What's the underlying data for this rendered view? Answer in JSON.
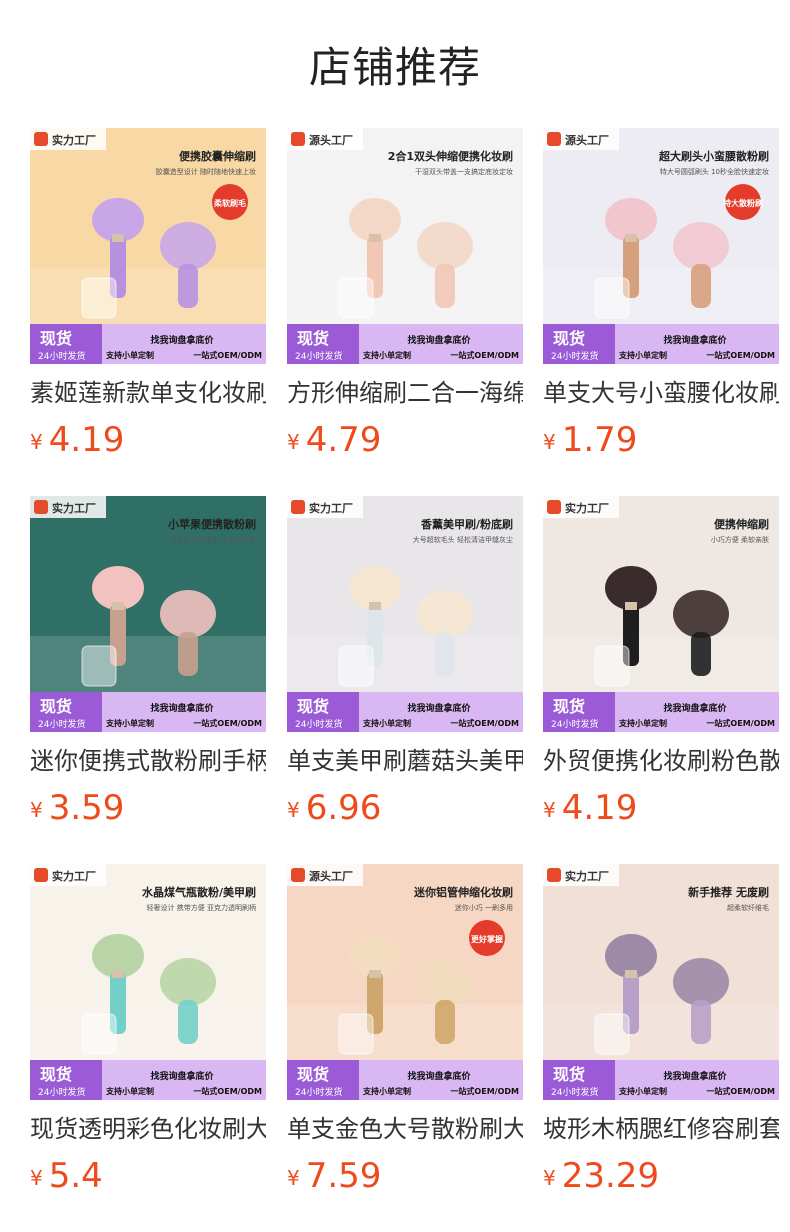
{
  "page_title": "店铺推荐",
  "currency": "¥",
  "colors": {
    "price": "#ee4a1c",
    "banner": "#9b5bd6",
    "banner_light": "#d9b7f2"
  },
  "products": [
    {
      "title": "素姬莲新款单支化妆刷",
      "price": "4.19",
      "image": {
        "bg": "#f8d9a6",
        "badge": "实力工厂",
        "headline": "便携胶囊伸缩刷",
        "subline": "胶囊造型设计 随时随地快速上妆",
        "sticker": "柔软刷毛",
        "tag_main": "现货",
        "tag_sub": "24小时发货",
        "banner_top": "找我询盘拿底价",
        "banner_left": "支持小单定制",
        "banner_right": "一站式OEM/ODM",
        "brush_head": "#c8a6e8",
        "brush_handle": "#b791e0"
      }
    },
    {
      "title": "方形伸缩刷二合一海绵",
      "price": "4.79",
      "image": {
        "bg": "#f3f3f3",
        "badge": "源头工厂",
        "headline": "2合1双头伸缩便携化妆刷",
        "subline": "干湿双头带盖一支搞定底妆定妆",
        "sticker": "",
        "tag_main": "现货",
        "tag_sub": "24小时发货",
        "banner_top": "找我询盘拿底价",
        "banner_left": "支持小单定制",
        "banner_right": "一站式OEM/ODM",
        "brush_head": "#f3d8c8",
        "brush_handle": "#f1c7b6"
      }
    },
    {
      "title": "单支大号小蛮腰化妆刷",
      "price": "1.79",
      "image": {
        "bg": "#ececf2",
        "badge": "源头工厂",
        "headline": "超大刷头小蛮腰散粉刷",
        "subline": "特大号圆弧刷头 10秒全脸快速定妆",
        "sticker": "特大散粉刷",
        "tag_main": "现货",
        "tag_sub": "24小时发货",
        "banner_top": "找我询盘拿底价",
        "banner_left": "支持小单定制",
        "banner_right": "一站式OEM/ODM",
        "brush_head": "#f2c6cf",
        "brush_handle": "#d7a07d"
      }
    },
    {
      "title": "迷你便携式散粉刷手柄",
      "price": "3.59",
      "image": {
        "bg": "#2f6f66",
        "badge": "实力工厂",
        "headline": "小苹果便携散粉刷",
        "subline": "轻松贴合苹果肌 上妆无死角",
        "sticker": "",
        "tag_main": "现货",
        "tag_sub": "24小时发货",
        "banner_top": "找我询盘拿底价",
        "banner_left": "支持小单定制",
        "banner_right": "一站式OEM/ODM",
        "brush_head": "#f2c2c0",
        "brush_handle": "#c8a090"
      }
    },
    {
      "title": "单支美甲刷蘑菇头美甲",
      "price": "6.96",
      "image": {
        "bg": "#e9e6ea",
        "badge": "实力工厂",
        "headline": "香薰美甲刷/粉底刷",
        "subline": "大号超软毛头 轻松清洁甲缝灰尘",
        "sticker": "",
        "tag_main": "现货",
        "tag_sub": "24小时发货",
        "banner_top": "找我询盘拿底价",
        "banner_left": "支持小单定制",
        "banner_right": "一站式OEM/ODM",
        "brush_head": "#f7e7d2",
        "brush_handle": "#dfe6ea"
      }
    },
    {
      "title": "外贸便携化妆刷粉色散",
      "price": "4.19",
      "image": {
        "bg": "#efe8e2",
        "badge": "实力工厂",
        "headline": "便携伸缩刷",
        "subline": "小巧方便 柔软亲肤",
        "sticker": "",
        "tag_main": "现货",
        "tag_sub": "24小时发货",
        "banner_top": "找我询盘拿底价",
        "banner_left": "支持小单定制",
        "banner_right": "一站式OEM/ODM",
        "brush_head": "#3a2c2c",
        "brush_handle": "#1e1e1e"
      }
    },
    {
      "title": "现货透明彩色化妆刷大",
      "price": "5.4",
      "image": {
        "bg": "#f7f2ea",
        "badge": "实力工厂",
        "headline": "水晶煤气瓶散粉/美甲刷",
        "subline": "轻奢设计 携带方便 亚克力透明刷柄",
        "sticker": "",
        "tag_main": "现货",
        "tag_sub": "24小时发货",
        "banner_top": "找我询盘拿底价",
        "banner_left": "支持小单定制",
        "banner_right": "一站式OEM/ODM",
        "brush_head": "#b9d5a7",
        "brush_handle": "#72d0c8"
      }
    },
    {
      "title": "单支金色大号散粉刷大",
      "price": "7.59",
      "image": {
        "bg": "#f6d7c4",
        "badge": "源头工厂",
        "headline": "迷你铝管伸缩化妆刷",
        "subline": "迷你小巧 一刷多用",
        "sticker": "更好掌握",
        "tag_main": "现货",
        "tag_sub": "24小时发货",
        "banner_top": "找我询盘拿底价",
        "banner_left": "支持小单定制",
        "banner_right": "一站式OEM/ODM",
        "brush_head": "#f3dcc0",
        "brush_handle": "#cfa66b"
      }
    },
    {
      "title": "坡形木柄腮红修容刷套",
      "price": "23.29",
      "image": {
        "bg": "#f0e0d6",
        "badge": "实力工厂",
        "headline": "新手推荐 无废刷",
        "subline": "超柔软纤维毛",
        "sticker": "",
        "tag_main": "现货",
        "tag_sub": "24小时发货",
        "banner_top": "找我询盘拿底价",
        "banner_left": "支持小单定制",
        "banner_right": "一站式OEM/ODM",
        "brush_head": "#9c8aa8",
        "brush_handle": "#b9a0c8"
      }
    }
  ]
}
